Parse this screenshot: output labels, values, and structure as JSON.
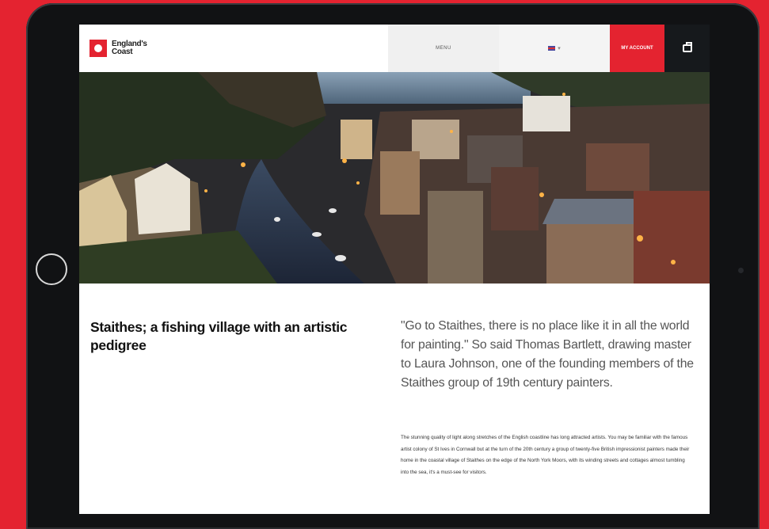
{
  "nav": {
    "logo_line1": "England's",
    "logo_line2": "Coast",
    "menu_label": "MENU",
    "language_label": "▾",
    "account_label": "MY ACCOUNT"
  },
  "article": {
    "title": "Staithes; a fishing village with an artistic pedigree",
    "quote": "\"Go to Staithes, there is no place like it in all the world for painting.\" So said Thomas Bartlett, drawing master to Laura Johnson, one of the founding members of the Staithes group of 19th century painters.",
    "body": "The stunning quality of light along stretches of the English coastline has long attracted artists. You may be familiar with the famous artist colony of St Ives in Cornwall but at the turn of the 20th century a group of twenty-five British impressionist painters made their home in the coastal village of Staithes on the edge of the North York Moors, with its winding streets and cottages almost tumbling into the sea, it's a must-see for visitors."
  },
  "colors": {
    "brand_red": "#e42330",
    "dark": "#16191c"
  },
  "icons": {
    "logo": "englands-coast-logo",
    "flag": "uk-flag-icon",
    "bag": "bag-icon"
  }
}
